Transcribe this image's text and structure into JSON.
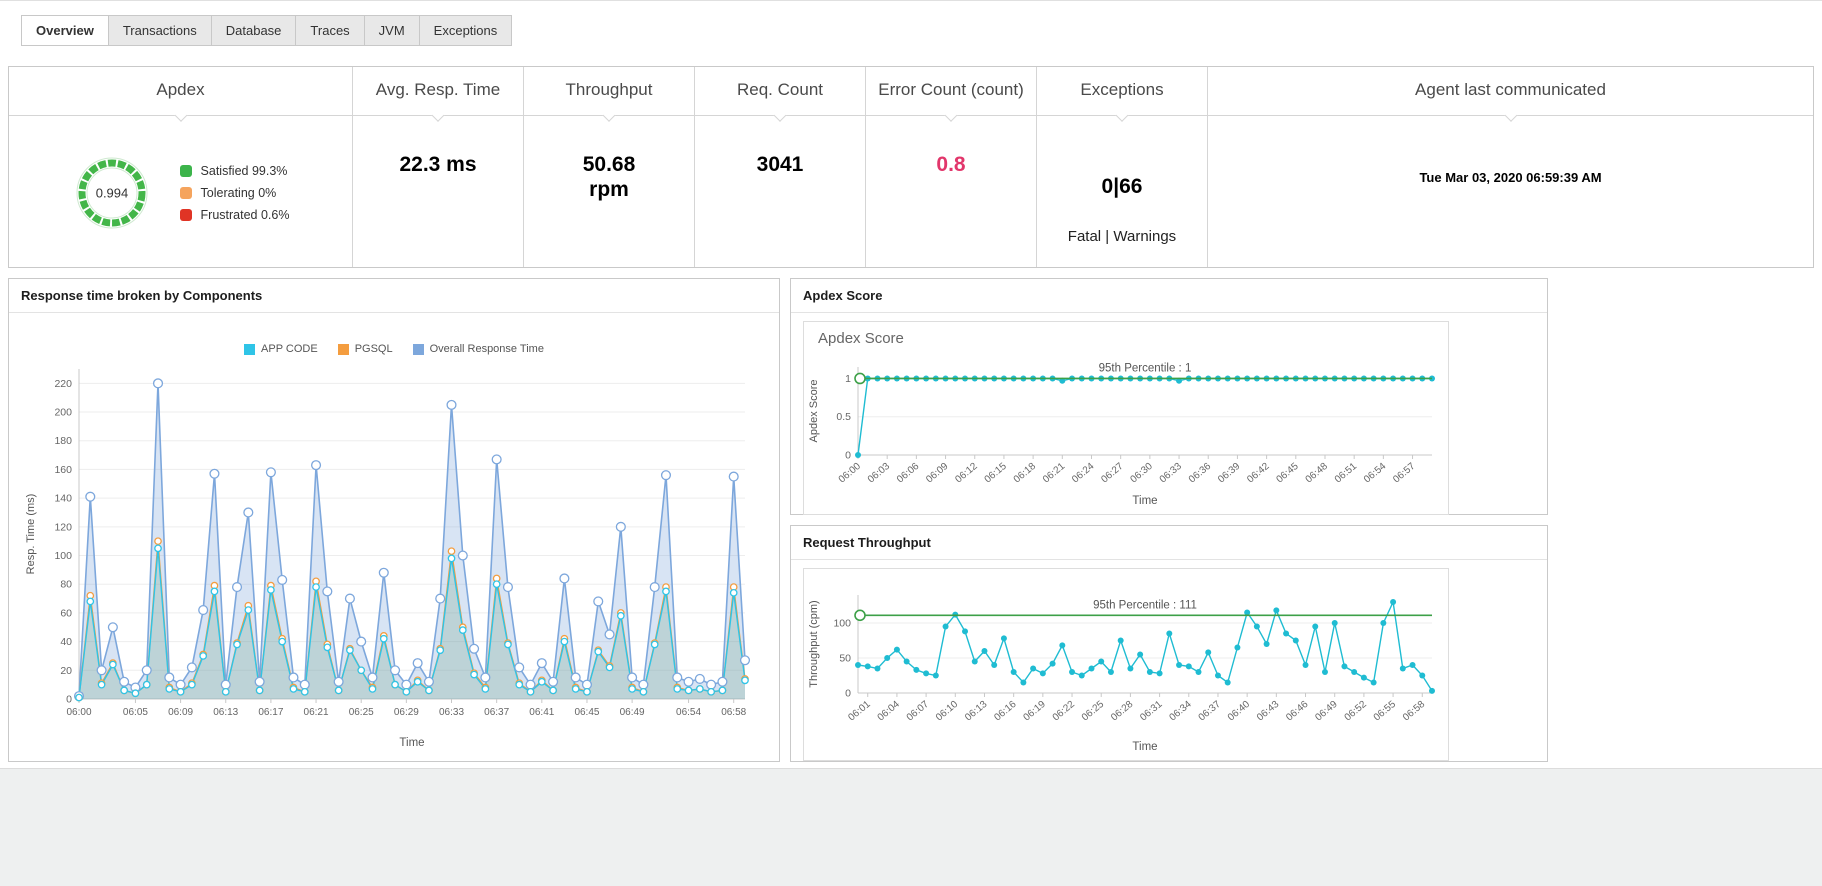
{
  "tabs": {
    "items": [
      {
        "label": "Overview",
        "active": true
      },
      {
        "label": "Transactions",
        "active": false
      },
      {
        "label": "Database",
        "active": false
      },
      {
        "label": "Traces",
        "active": false
      },
      {
        "label": "JVM",
        "active": false
      },
      {
        "label": "Exceptions",
        "active": false
      }
    ]
  },
  "summary_cards": {
    "apdex": {
      "title": "Apdex",
      "value": "0.994",
      "legend": [
        {
          "label": "Satisfied 99.3%",
          "color": "#3cb44b"
        },
        {
          "label": "Tolerating 0%",
          "color": "#f5a45d"
        },
        {
          "label": "Frustrated 0.6%",
          "color": "#e03425"
        }
      ],
      "ring_color": "#43b649"
    },
    "avg_resp_time": {
      "title": "Avg. Resp. Time",
      "value": "22.3 ms"
    },
    "throughput": {
      "title": "Throughput",
      "value": "50.68",
      "unit": "rpm"
    },
    "req_count": {
      "title": "Req. Count",
      "value": "3041"
    },
    "error_count": {
      "title": "Error Count (count)",
      "value": "0.8",
      "color": "#e2366b"
    },
    "exceptions": {
      "title": "Exceptions",
      "value": "0|66",
      "sub": "Fatal | Warnings"
    },
    "agent": {
      "title": "Agent last communicated",
      "value": "Tue Mar 03, 2020 06:59:39 AM"
    }
  },
  "panels": {
    "response_time": {
      "title": "Response time broken by Components"
    },
    "apdex_score": {
      "title": "Apdex Score",
      "chart_title": "Apdex Score"
    },
    "request_throughput": {
      "title": "Request Throughput"
    }
  },
  "chart_data": [
    {
      "id": "response_time",
      "type": "line",
      "title": "Response time broken by Components",
      "xlabel": "Time",
      "ylabel": "Resp. Time (ms)",
      "ylim": [
        0,
        230
      ],
      "yticks": [
        0,
        20,
        40,
        60,
        80,
        100,
        120,
        140,
        160,
        180,
        200,
        220
      ],
      "legend_position": "top",
      "x": [
        "06:00",
        "06:01",
        "06:02",
        "06:03",
        "06:04",
        "06:05",
        "06:06",
        "06:07",
        "06:08",
        "06:09",
        "06:10",
        "06:11",
        "06:12",
        "06:13",
        "06:14",
        "06:15",
        "06:16",
        "06:17",
        "06:18",
        "06:19",
        "06:20",
        "06:21",
        "06:22",
        "06:23",
        "06:24",
        "06:25",
        "06:26",
        "06:27",
        "06:28",
        "06:29",
        "06:30",
        "06:31",
        "06:32",
        "06:33",
        "06:34",
        "06:35",
        "06:36",
        "06:37",
        "06:38",
        "06:39",
        "06:40",
        "06:41",
        "06:42",
        "06:43",
        "06:44",
        "06:45",
        "06:46",
        "06:47",
        "06:48",
        "06:49",
        "06:50",
        "06:51",
        "06:52",
        "06:53",
        "06:54",
        "06:55",
        "06:56",
        "06:57",
        "06:58",
        "06:59"
      ],
      "x_ticks": [
        "06:00",
        "06:05",
        "06:09",
        "06:13",
        "06:17",
        "06:21",
        "06:25",
        "06:29",
        "06:33",
        "06:37",
        "06:41",
        "06:45",
        "06:49",
        "06:54",
        "06:58"
      ],
      "series": [
        {
          "name": "Overall Response Time",
          "color": "#7da7dc",
          "fill": "rgba(125,167,220,0.30)",
          "values": [
            2,
            141,
            20,
            50,
            12,
            8,
            20,
            220,
            15,
            10,
            22,
            62,
            157,
            10,
            78,
            130,
            12,
            158,
            83,
            15,
            10,
            163,
            75,
            12,
            70,
            40,
            15,
            88,
            20,
            10,
            25,
            12,
            70,
            205,
            100,
            35,
            15,
            167,
            78,
            22,
            10,
            25,
            12,
            84,
            15,
            10,
            68,
            45,
            120,
            15,
            10,
            78,
            156,
            15,
            12,
            14,
            10,
            12,
            155,
            27
          ]
        },
        {
          "name": "PGSQL",
          "color": "#f49d3f",
          "fill": "rgba(244,157,63,0.18)",
          "values": [
            1,
            72,
            11,
            25,
            6,
            4,
            10,
            110,
            8,
            5,
            11,
            31,
            79,
            5,
            39,
            65,
            6,
            79,
            42,
            8,
            5,
            82,
            38,
            6,
            35,
            20,
            8,
            44,
            10,
            5,
            13,
            6,
            35,
            103,
            50,
            18,
            8,
            84,
            39,
            11,
            5,
            13,
            6,
            42,
            8,
            5,
            34,
            23,
            60,
            8,
            5,
            39,
            78,
            8,
            6,
            7,
            5,
            6,
            78,
            14
          ]
        },
        {
          "name": "APP CODE",
          "color": "#2fc4e7",
          "fill": "rgba(47,196,231,0.18)",
          "values": [
            1,
            68,
            10,
            24,
            6,
            4,
            10,
            105,
            7,
            5,
            10,
            30,
            75,
            5,
            38,
            62,
            6,
            76,
            40,
            7,
            5,
            78,
            36,
            6,
            34,
            20,
            7,
            42,
            10,
            5,
            12,
            6,
            34,
            98,
            48,
            17,
            7,
            80,
            38,
            10,
            5,
            12,
            6,
            40,
            7,
            5,
            33,
            22,
            58,
            7,
            5,
            38,
            75,
            7,
            6,
            7,
            5,
            6,
            74,
            13
          ]
        }
      ],
      "legend_order": [
        "APP CODE",
        "PGSQL",
        "Overall Response Time"
      ]
    },
    {
      "id": "apdex_score",
      "type": "line",
      "title": "Apdex Score",
      "xlabel": "Time",
      "ylabel": "Apdex Score",
      "ylim": [
        0,
        1.15
      ],
      "yticks": [
        0,
        0.5,
        1
      ],
      "x": [
        "06:00",
        "06:01",
        "06:02",
        "06:03",
        "06:04",
        "06:05",
        "06:06",
        "06:07",
        "06:08",
        "06:09",
        "06:10",
        "06:11",
        "06:12",
        "06:13",
        "06:14",
        "06:15",
        "06:16",
        "06:17",
        "06:18",
        "06:19",
        "06:20",
        "06:21",
        "06:22",
        "06:23",
        "06:24",
        "06:25",
        "06:26",
        "06:27",
        "06:28",
        "06:29",
        "06:30",
        "06:31",
        "06:32",
        "06:33",
        "06:34",
        "06:35",
        "06:36",
        "06:37",
        "06:38",
        "06:39",
        "06:40",
        "06:41",
        "06:42",
        "06:43",
        "06:44",
        "06:45",
        "06:46",
        "06:47",
        "06:48",
        "06:49",
        "06:50",
        "06:51",
        "06:52",
        "06:53",
        "06:54",
        "06:55",
        "06:56",
        "06:57",
        "06:58",
        "06:59"
      ],
      "x_ticks": [
        "06:00",
        "06:03",
        "06:06",
        "06:09",
        "06:12",
        "06:15",
        "06:18",
        "06:21",
        "06:24",
        "06:27",
        "06:30",
        "06:33",
        "06:36",
        "06:39",
        "06:42",
        "06:45",
        "06:48",
        "06:51",
        "06:54",
        "06:57"
      ],
      "series": [
        {
          "name": "Apdex Score",
          "color": "#1fbcd2",
          "values": [
            0,
            1,
            1,
            1,
            1,
            1,
            1,
            1,
            1,
            1,
            1,
            1,
            1,
            1,
            1,
            1,
            1,
            1,
            1,
            1,
            1,
            0.97,
            1,
            1,
            1,
            1,
            1,
            1,
            1,
            1,
            1,
            1,
            1,
            0.97,
            1,
            1,
            1,
            1,
            1,
            1,
            1,
            1,
            1,
            1,
            1,
            1,
            1,
            1,
            1,
            1,
            1,
            1,
            1,
            1,
            1,
            1,
            1,
            1,
            1,
            1
          ]
        }
      ],
      "percentile": {
        "value": 1,
        "label": "95th Percentile : 1",
        "color": "#3da048"
      }
    },
    {
      "id": "request_throughput",
      "type": "line",
      "title": "Request Throughput",
      "xlabel": "Time",
      "ylabel": "Throughput (cpm)",
      "ylim": [
        0,
        140
      ],
      "yticks": [
        0,
        50,
        100
      ],
      "x": [
        "06:00",
        "06:01",
        "06:02",
        "06:03",
        "06:04",
        "06:05",
        "06:06",
        "06:07",
        "06:08",
        "06:09",
        "06:10",
        "06:11",
        "06:12",
        "06:13",
        "06:14",
        "06:15",
        "06:16",
        "06:17",
        "06:18",
        "06:19",
        "06:20",
        "06:21",
        "06:22",
        "06:23",
        "06:24",
        "06:25",
        "06:26",
        "06:27",
        "06:28",
        "06:29",
        "06:30",
        "06:31",
        "06:32",
        "06:33",
        "06:34",
        "06:35",
        "06:36",
        "06:37",
        "06:38",
        "06:39",
        "06:40",
        "06:41",
        "06:42",
        "06:43",
        "06:44",
        "06:45",
        "06:46",
        "06:47",
        "06:48",
        "06:49",
        "06:50",
        "06:51",
        "06:52",
        "06:53",
        "06:54",
        "06:55",
        "06:56",
        "06:57",
        "06:58",
        "06:59"
      ],
      "x_ticks": [
        "06:01",
        "06:04",
        "06:07",
        "06:10",
        "06:13",
        "06:16",
        "06:19",
        "06:22",
        "06:25",
        "06:28",
        "06:31",
        "06:34",
        "06:37",
        "06:40",
        "06:43",
        "06:46",
        "06:49",
        "06:52",
        "06:55",
        "06:58"
      ],
      "series": [
        {
          "name": "Request Throughput",
          "color": "#1fbcd2",
          "values": [
            40,
            38,
            35,
            50,
            62,
            45,
            33,
            28,
            25,
            95,
            112,
            88,
            45,
            60,
            40,
            78,
            30,
            15,
            35,
            28,
            42,
            68,
            30,
            25,
            35,
            45,
            30,
            75,
            35,
            55,
            30,
            28,
            85,
            40,
            38,
            30,
            58,
            25,
            15,
            65,
            115,
            95,
            70,
            118,
            85,
            75,
            40,
            95,
            30,
            100,
            38,
            30,
            22,
            15,
            100,
            130,
            35,
            40,
            25,
            3
          ]
        }
      ],
      "percentile": {
        "value": 111,
        "label": "95th Percentile : 111",
        "color": "#3da048"
      }
    }
  ]
}
